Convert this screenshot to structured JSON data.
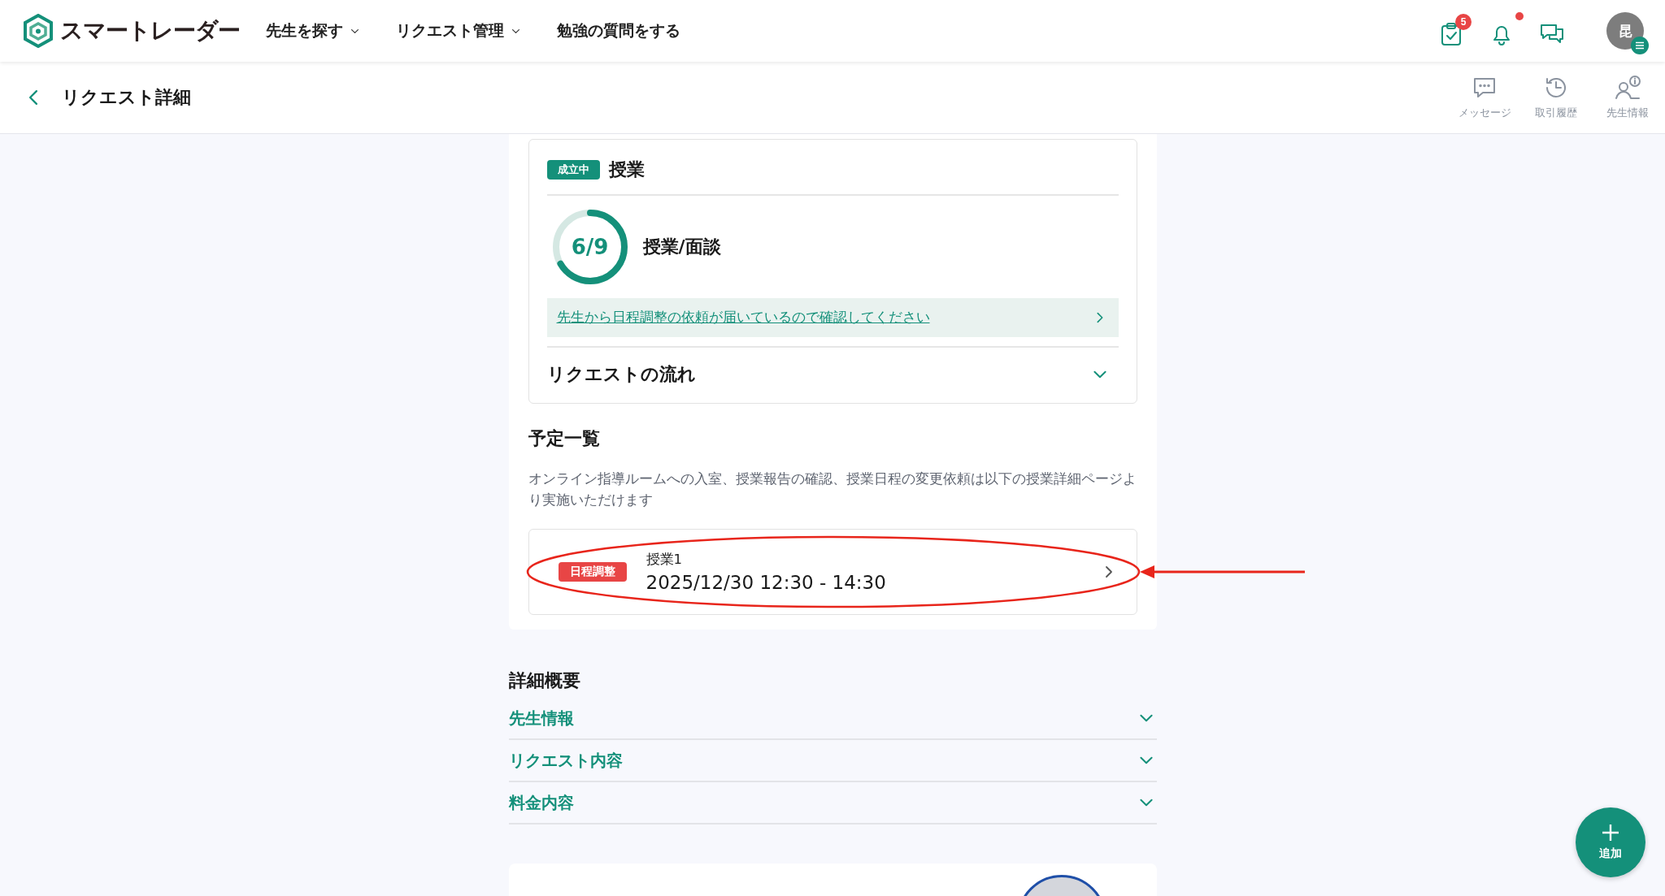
{
  "header": {
    "brand": "スマートレーダー",
    "nav": [
      {
        "label": "先生を探す",
        "dropdown": true
      },
      {
        "label": "リクエスト管理",
        "dropdown": true
      },
      {
        "label": "勉強の質問をする",
        "dropdown": false
      }
    ],
    "icons": [
      {
        "kind": "tasks",
        "badge": "5"
      },
      {
        "kind": "bell",
        "dot": true
      },
      {
        "kind": "chat"
      }
    ],
    "avatar": {
      "initial": "昆"
    }
  },
  "subheader": {
    "title": "リクエスト詳細",
    "actions": [
      {
        "kind": "message",
        "label": "メッセージ"
      },
      {
        "kind": "history",
        "label": "取引履歴"
      },
      {
        "kind": "teacher",
        "label": "先生情報"
      }
    ]
  },
  "request_card": {
    "status": "成立中",
    "title": "授業",
    "progress": {
      "count": "6/9",
      "level": 0.667,
      "label": "授業/面談"
    },
    "notice": "先生から日程調整の依頼が届いているので確認してください",
    "flow": {
      "label": "リクエストの流れ",
      "expanded": false
    }
  },
  "schedule": {
    "title": "予定一覧",
    "description": "オンライン指導ルームへの入室、授業報告の確認、授業日程の変更依頼は以下の授業詳細ページより実施いただけます",
    "items": [
      {
        "tag": "日程調整",
        "name": "授業1",
        "datetime": "2025/12/30 12:30 - 14:30",
        "highlighted": true
      }
    ]
  },
  "details": {
    "title": "詳細概要",
    "sections": [
      {
        "label": "先生情報",
        "expanded": false
      },
      {
        "label": "リクエスト内容",
        "expanded": false
      },
      {
        "label": "料金内容",
        "expanded": false
      }
    ]
  },
  "fab": {
    "label": "追加"
  }
}
